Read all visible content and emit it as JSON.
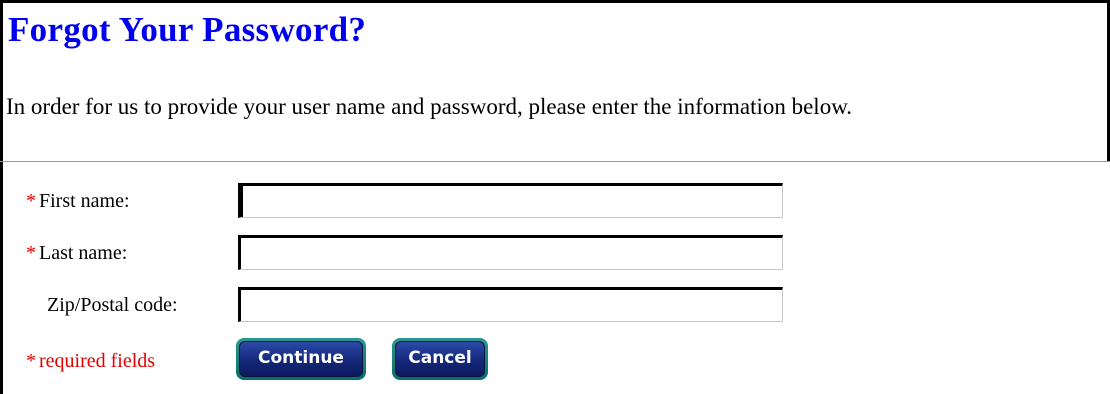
{
  "page": {
    "title": "Forgot Your Password?",
    "intro": "In order for us to provide your user name and password, please enter the information below."
  },
  "form": {
    "required_marker": "*",
    "fields": [
      {
        "label": "First name:",
        "required": true,
        "value": ""
      },
      {
        "label": "Last name:",
        "required": true,
        "value": ""
      },
      {
        "label": "Zip/Postal code:",
        "required": false,
        "value": ""
      }
    ],
    "required_note": "required fields",
    "continue_label": "Continue",
    "cancel_label": "Cancel"
  },
  "colors": {
    "title": "#0000ee",
    "required": "#e00000",
    "button_face": "#14287a",
    "button_ring": "#0a6e63"
  }
}
